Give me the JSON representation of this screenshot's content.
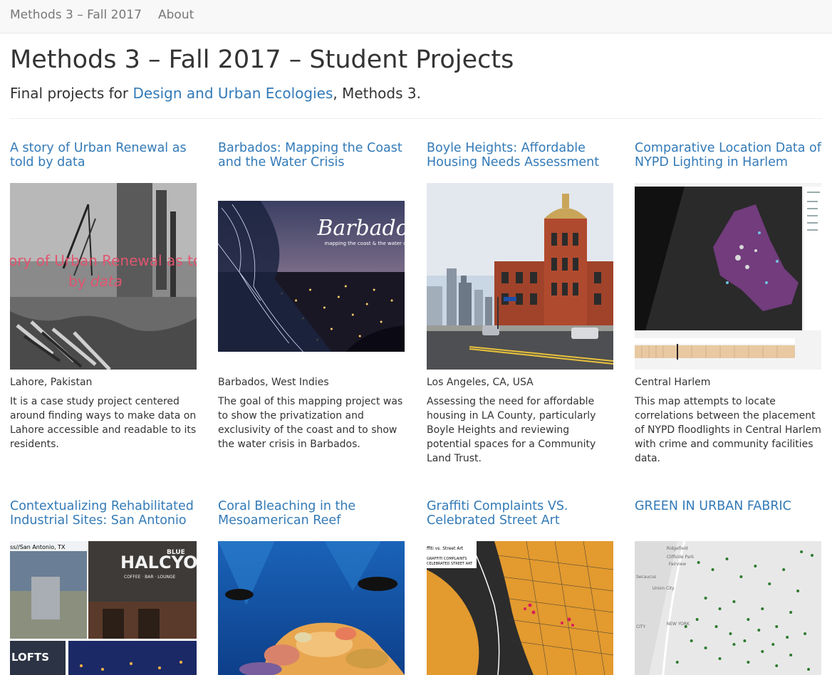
{
  "navbar": {
    "brand": "Methods 3 – Fall 2017",
    "about": "About"
  },
  "header": {
    "title": "Methods 3 – Fall 2017 – Student Projects",
    "subtitle_prefix": "Final projects for ",
    "subtitle_link": "Design and Urban Ecologies",
    "subtitle_suffix": ", Methods 3."
  },
  "projects": [
    {
      "title": "A story of Urban Renewal as told by data",
      "image_text_line1": "ory of Urban Renewal as to",
      "image_text_line2a": "by ",
      "image_text_line2b": "data",
      "location": "Lahore, Pakistan",
      "description": "It is a case study project centered around finding ways to make data on Lahore accessible and readable to its residents."
    },
    {
      "title": "Barbados: Mapping the Coast and the Water Crisis",
      "image_text_line1": "Barbados",
      "image_text_line2": "mapping the coast & the water cri",
      "location": "Barbados, West Indies",
      "description": "The goal of this mapping project was to show the privatization and exclusivity of the coast and to show the water crisis in Barbados."
    },
    {
      "title": "Boyle Heights: Affordable Housing Needs Assessment",
      "location": "Los Angeles, CA, USA",
      "description": "Assessing the need for affordable housing in LA County, particularly Boyle Heights and reviewing potential spaces for a Community Land Trust."
    },
    {
      "title": "Comparative Location Data of NYPD Lighting in Harlem",
      "location": "Central Harlem",
      "description": "This map attempts to locate correlations between the placement of NYPD floodlights in Central Harlem with crime and community facilities data."
    },
    {
      "title": "Contextualizing Rehabilitated Industrial Sites: San Antonio",
      "image_text_line1": "ss//San Antonio, TX",
      "image_text_line2": "HALCYON",
      "image_text_line3": "BLUE",
      "image_text_line4": "COFFEE · BAR · LOUNGE",
      "image_text_line5": "LOFTS"
    },
    {
      "title": "Coral Bleaching in the Mesoamerican Reef"
    },
    {
      "title": "Graffiti Complaints VS. Celebrated Street Art",
      "image_text_line1": "ffiti vs. Street Art",
      "image_text_line2": "GRAFFITI COMPLAINTS",
      "image_text_line3": "CELEBRATED STREET ART"
    },
    {
      "title": "GREEN IN URBAN FABRIC",
      "image_text_line1": "Ridgefield",
      "image_text_line2": "Cliffside Park",
      "image_text_line3": "Fairview",
      "image_text_line4": "Secaucus",
      "image_text_line5": "Union City",
      "image_text_line6": "CITY",
      "image_text_line7": "NEW YORK"
    }
  ],
  "colors": {
    "link": "#337ab7",
    "text": "#333333",
    "nav_bg": "#f8f8f8",
    "nav_text": "#777777"
  }
}
